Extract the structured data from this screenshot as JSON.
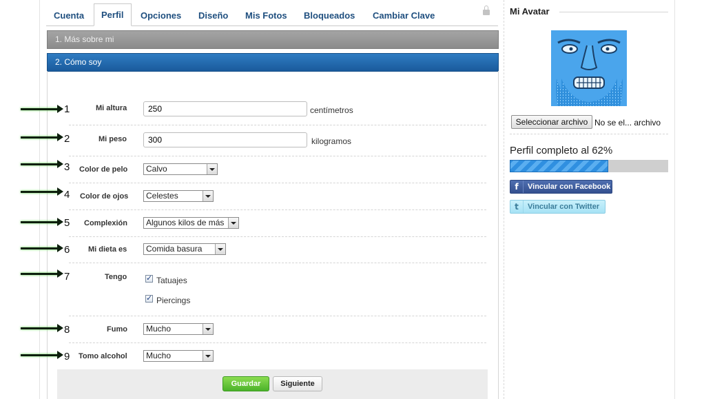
{
  "tabs": [
    "Cuenta",
    "Perfil",
    "Opciones",
    "Diseño",
    "Mis Fotos",
    "Bloqueados",
    "Cambiar Clave"
  ],
  "sections": {
    "more_about": "1. Más sobre mi",
    "how_i_am": "2. Cómo soy"
  },
  "fields": {
    "height": {
      "num": "1",
      "label": "Mi altura",
      "value": "250",
      "unit": "centímetros"
    },
    "weight": {
      "num": "2",
      "label": "Mi peso",
      "value": "300",
      "unit": "kilogramos"
    },
    "hair": {
      "num": "3",
      "label": "Color de pelo",
      "value": "Calvo"
    },
    "eyes": {
      "num": "4",
      "label": "Color de ojos",
      "value": "Celestes"
    },
    "build": {
      "num": "5",
      "label": "Complexión",
      "value": "Algunos kilos de más"
    },
    "diet": {
      "num": "6",
      "label": "Mi dieta es",
      "value": "Comida basura"
    },
    "have": {
      "num": "7",
      "label": "Tengo",
      "options": [
        "Tatuajes",
        "Piercings"
      ]
    },
    "smoke": {
      "num": "8",
      "label": "Fumo",
      "value": "Mucho"
    },
    "alcohol": {
      "num": "9",
      "label": "Tomo alcohol",
      "value": "Mucho"
    }
  },
  "buttons": {
    "save": "Guardar",
    "next": "Siguiente"
  },
  "sidebar": {
    "title": "Mi Avatar",
    "file_button": "Seleccionar archivo",
    "file_text": "No se el... archivo",
    "progress_label": "Perfil completo al 62%",
    "progress_value": 0.62,
    "facebook": "Vincular con Facebook",
    "twitter": "Vincular con Twitter"
  },
  "colors": {
    "tab_text": "#1f4f7f",
    "section_blue": "#1a5a9c",
    "save_green": "#4bb32a",
    "progress_blue": "#2f8fe0",
    "avatar_blue": "#3c9be6"
  }
}
